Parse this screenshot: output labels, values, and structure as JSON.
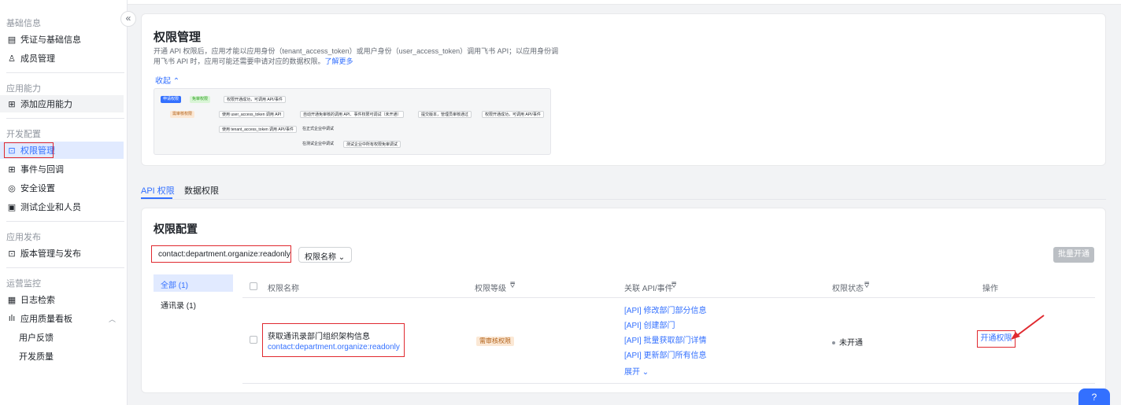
{
  "sidebar": {
    "collapse_icon": "«",
    "groups": {
      "basic": "基础信息",
      "abilities": "应用能力",
      "dev_config": "开发配置",
      "publish": "应用发布",
      "ops": "运营监控"
    },
    "items": {
      "credentials": "凭证与基础信息",
      "members": "成员管理",
      "add_ability": "添加应用能力",
      "permissions": "权限管理",
      "events": "事件与回调",
      "security": "安全设置",
      "test_org": "测试企业和人员",
      "versions": "版本管理与发布",
      "logs": "日志检索",
      "quality": "应用质量看板",
      "feedback": "用户反馈",
      "dev_quality": "开发质量"
    }
  },
  "intro": {
    "title": "权限管理",
    "desc": "开通 API 权限后，应用才能以应用身份（tenant_access_token）或用户身份（user_access_token）调用飞书 API；以应用身份调用飞书 API 时，应用可能还需要申请对应的数据权限。",
    "learn_more": "了解更多",
    "collapse": "收起 ⌃",
    "flow": {
      "start": "申请权限",
      "free": "免审权限",
      "free_result": "权限开通成功，可调用 API/事件",
      "review": "需审核权限",
      "use_uat": "使用 user_access_token 调用 API",
      "auto_ok": "自动开通免审核的调用 API、事件权限可调试（未开通）",
      "submit": "提交版本，管理员审核通过",
      "final": "权限开通成功，可调用 API/事件",
      "use_tat": "使用 tenant_access_token 调用 API/事件",
      "formal": "在正式企业中调试",
      "test": "在测试企业中调试",
      "test_result": "测试企业中所有权限免审调试"
    }
  },
  "tabs": [
    "API 权限",
    "数据权限"
  ],
  "config": {
    "title": "权限配置",
    "search_value": "contact:department.organize:readonly",
    "filter_label": "权限名称",
    "batch_button": "批量开通",
    "categories": [
      {
        "label": "全部 (1)"
      },
      {
        "label": "通讯录 (1)"
      }
    ],
    "columns": {
      "name": "权限名称",
      "level": "权限等级",
      "apis": "关联 API/事件",
      "status": "权限状态",
      "action": "操作"
    },
    "row": {
      "name": "获取通讯录部门组织架构信息",
      "code": "contact:department.organize:readonly",
      "level": "需审核权限",
      "apis": [
        "[API] 修改部门部分信息",
        "[API] 创建部门",
        "[API] 批量获取部门详情",
        "[API] 更新部门所有信息"
      ],
      "expand": "展开 ⌄",
      "status": "未开通",
      "action": "开通权限"
    }
  },
  "colors": {
    "accent": "#3370ff",
    "highlight": "#e0292f"
  }
}
